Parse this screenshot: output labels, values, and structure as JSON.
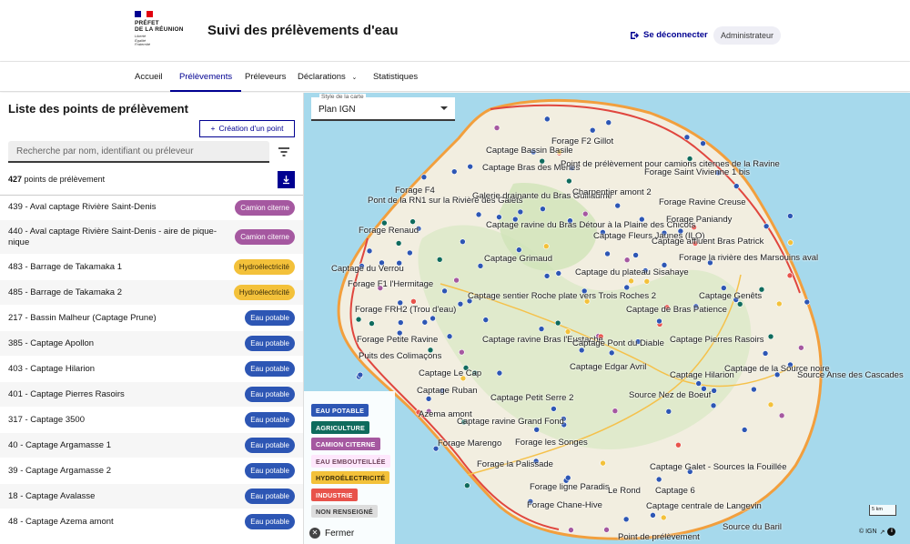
{
  "header": {
    "logo": {
      "line1": "PRÉFET",
      "line2": "DE LA RÉUNION",
      "motto1": "Liberté",
      "motto2": "Égalité",
      "motto3": "Fraternité"
    },
    "site_title": "Suivi des prélèvements d'eau",
    "logout_label": "Se déconnecter",
    "role_badge": "Administrateur"
  },
  "nav": {
    "items": [
      "Accueil",
      "Prélèvements",
      "Préleveurs",
      "Déclarations",
      "Statistiques"
    ],
    "active": "Prélèvements"
  },
  "sidebar": {
    "title": "Liste des points de prélèvement",
    "create_button": "Création d'un point",
    "search_placeholder": "Recherche par nom, identifiant ou préleveur",
    "count_number": "427",
    "count_suffix": "points de prélèvement",
    "rows": [
      {
        "name": "439 - Aval captage Rivière Saint-Denis",
        "badge": "Camion citerne",
        "color": "#a558a0"
      },
      {
        "name": "440 - Aval captage Rivière Saint-Denis - aire de pique-nique",
        "badge": "Camion citerne",
        "color": "#a558a0"
      },
      {
        "name": "483 - Barrage de Takamaka 1",
        "badge": "Hydroélectricité",
        "color": "#f3c13a"
      },
      {
        "name": "485 - Barrage de Takamaka 2",
        "badge": "Hydroélectricité",
        "color": "#f3c13a"
      },
      {
        "name": "217 - Bassin Malheur (Captage Prune)",
        "badge": "Eau potable",
        "color": "#2d56b4"
      },
      {
        "name": "385 - Captage Apollon",
        "badge": "Eau potable",
        "color": "#2d56b4"
      },
      {
        "name": "403 - Captage Hilarion",
        "badge": "Eau potable",
        "color": "#2d56b4"
      },
      {
        "name": "401 - Captage Pierres Rasoirs",
        "badge": "Eau potable",
        "color": "#2d56b4"
      },
      {
        "name": "317 - Captage 3500",
        "badge": "Eau potable",
        "color": "#2d56b4"
      },
      {
        "name": "40 - Captage Argamasse 1",
        "badge": "Eau potable",
        "color": "#2d56b4"
      },
      {
        "name": "39 - Captage Argamasse 2",
        "badge": "Eau potable",
        "color": "#2d56b4"
      },
      {
        "name": "18 - Captage Avalasse",
        "badge": "Eau potable",
        "color": "#2d56b4"
      },
      {
        "name": "48 - Captage Azema amont",
        "badge": "Eau potable",
        "color": "#2d56b4"
      }
    ]
  },
  "map": {
    "style_label": "Style de la carte",
    "style_value": "Plan IGN",
    "legend": [
      {
        "label": "EAU POTABLE",
        "bg": "#2d56b4",
        "fg": "#ffffff"
      },
      {
        "label": "AGRICULTURE",
        "bg": "#0f6b5d",
        "fg": "#ffffff"
      },
      {
        "label": "CAMION CITERNE",
        "bg": "#a558a0",
        "fg": "#ffffff"
      },
      {
        "label": "EAU EMBOUTEILLÉE",
        "bg": "#fee7fc",
        "fg": "#6e445a"
      },
      {
        "label": "HYDROÉLECTRICITÉ",
        "bg": "#f3c13a",
        "fg": "#3b2e0b"
      },
      {
        "label": "INDUSTRIE",
        "bg": "#e8534b",
        "fg": "#ffffff"
      },
      {
        "label": "NON RENSEIGNÉ",
        "bg": "#dddddd",
        "fg": "#3a3a3a"
      }
    ],
    "close_label": "Fermer",
    "scale_label": "5 km",
    "attribution": "© IGN",
    "labels": [
      "Captage Bassin Basile",
      "Forage F2 Gillot",
      "Captage Bras des Merles",
      "Point de prélèvement pour camions citernes de la Ravine",
      "Forage Saint Vivienne 1 bis",
      "Forage F4",
      "Pont de la RN1 sur la Rivière des Galets",
      "Galerie drainante du Bras Guillaume",
      "Charpentier amont 2",
      "Forage Ravine Creuse",
      "Forage Renaud",
      "Captage ravine du Bras Détour à la Plaine des Chicots",
      "Captage Fleurs Jaunes (ILO)",
      "Forage Paniandy",
      "Captage affluent Bras Patrick",
      "Captage Grimaud",
      "Captage du Verrou",
      "Captage du plateau Sisahaye",
      "Forage la rivière des Marsouins aval",
      "Captage Genêts",
      "Forage F1 l'Hermitage",
      "Captage sentier Roche plate vers Trois Roches 2",
      "Forage FRH2 (Trou d'eau)",
      "Captage de Bras Patience",
      "Forage Petite Ravine",
      "Captage ravine Bras l'Eustache",
      "Captage Pont du Diable",
      "Captage Pierres Rasoirs",
      "Puits des Colimaçons",
      "Captage Edgar Avril",
      "Captage de la Source noire",
      "Captage Le Cap",
      "Captage Hilarion",
      "Source Anse des Cascades",
      "Captage Ruban",
      "Captage Petit Serre 2",
      "Source Nez de Boeuf",
      "Captage ravine Grand Fond",
      "Azema amont",
      "Forage Marengo",
      "Forage les Songes",
      "Forage la Palissade",
      "Forage ligne Paradis",
      "Captage Galet - Sources la Fouillée",
      "Le Rond",
      "Captage 6",
      "Forage Chane-Hive",
      "Captage centrale de Langevin",
      "Source du Baril",
      "Point de prélèvement"
    ]
  }
}
